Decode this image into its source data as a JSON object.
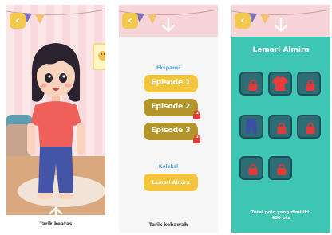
{
  "colors": {
    "accent_yellow": "#f2c53c",
    "locked_gold": "#b4952a",
    "teal_bg": "#3ec5b3",
    "lock_red": "#e04040",
    "title_blue": "#4aa3d8"
  },
  "screen1": {
    "back_icon": "chevron-left-icon",
    "swipe_hint": "Tarik keatas"
  },
  "screen2": {
    "back_icon": "chevron-left-icon",
    "section_expansion": "Ekspansi",
    "episodes": [
      {
        "label": "Episode 1",
        "sub": "",
        "locked": false
      },
      {
        "label": "Episode 2",
        "sub": "",
        "locked": true
      },
      {
        "label": "Episode 3",
        "sub": "",
        "locked": true
      }
    ],
    "section_collection": "Koleksi",
    "collection_button": "Lemari Almira",
    "swipe_hint": "Tarik kebawah"
  },
  "screen3": {
    "back_icon": "chevron-left-icon",
    "title": "Lemari Almira",
    "total_points_label": "Total poin yang dimiliki:",
    "total_points_value": "450 pts"
  }
}
